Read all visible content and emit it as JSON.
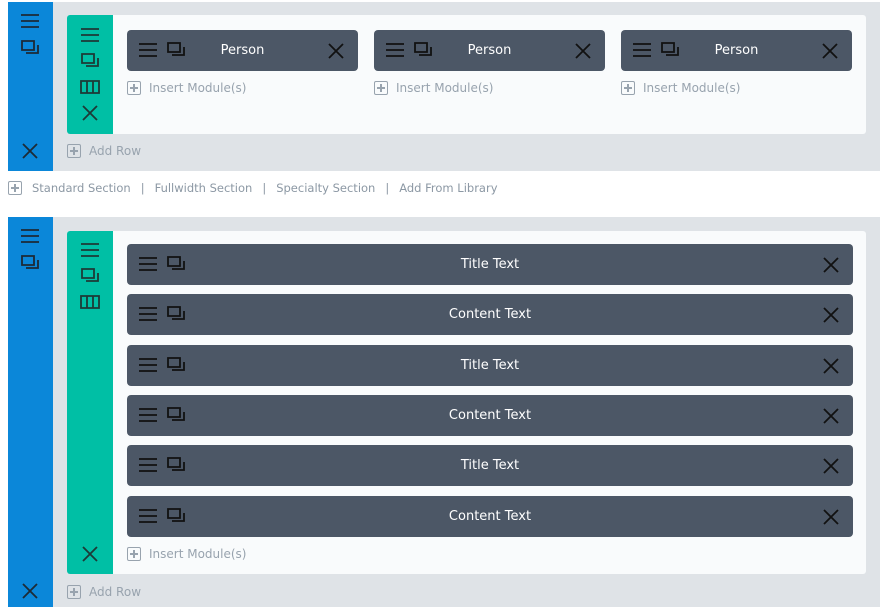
{
  "sections": [
    {
      "rows": [
        {
          "modules": [
            {
              "label": "Person"
            },
            {
              "label": "Person"
            },
            {
              "label": "Person"
            }
          ],
          "insert_label": "Insert Module(s)"
        }
      ],
      "add_row_label": "Add Row"
    },
    {
      "rows": [
        {
          "modules": [
            {
              "label": "Title Text"
            },
            {
              "label": "Content Text"
            },
            {
              "label": "Title Text"
            },
            {
              "label": "Content Text"
            },
            {
              "label": "Title Text"
            },
            {
              "label": "Content Text"
            }
          ],
          "insert_label": "Insert Module(s)"
        }
      ],
      "add_row_label": "Add Row"
    }
  ],
  "section_links": {
    "standard": "Standard Section",
    "fullwidth": "Fullwidth Section",
    "specialty": "Specialty Section",
    "library": "Add From Library",
    "separator": "|"
  },
  "colors": {
    "section_bar": "#0b87d9",
    "row_bar": "#00bfa5",
    "module": "#4c5766"
  }
}
